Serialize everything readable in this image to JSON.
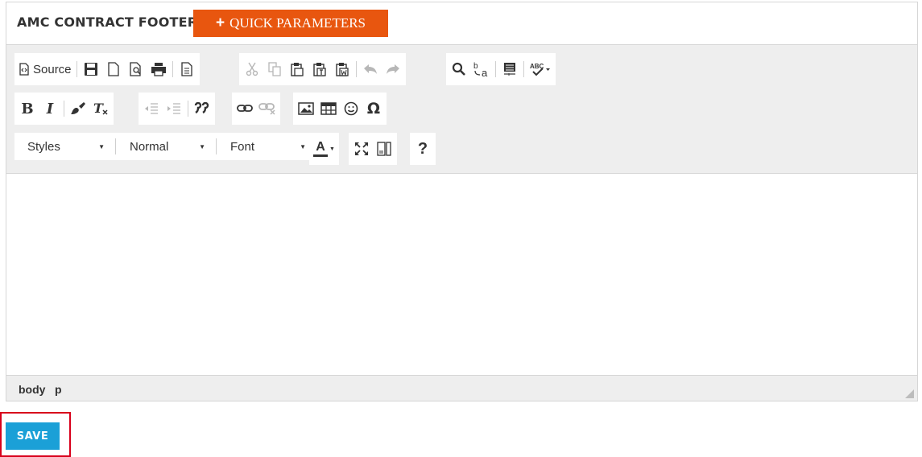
{
  "header": {
    "title": "AMC CONTRACT FOOTER",
    "quick_params_label": "QUICK PARAMETERS",
    "quick_params_icon": "plus-icon"
  },
  "toolbar": {
    "source_label": "Source",
    "styles_label": "Styles",
    "format_label": "Normal",
    "font_label": "Font",
    "text_color_glyph": "A",
    "help_glyph": "?"
  },
  "statusbar": {
    "path": [
      "body",
      "p"
    ]
  },
  "footer": {
    "save_label": "SAVE"
  },
  "colors": {
    "quick_params_bg": "#e8560f",
    "save_bg": "#1ba0d7",
    "highlight_outline": "#d8001b"
  }
}
